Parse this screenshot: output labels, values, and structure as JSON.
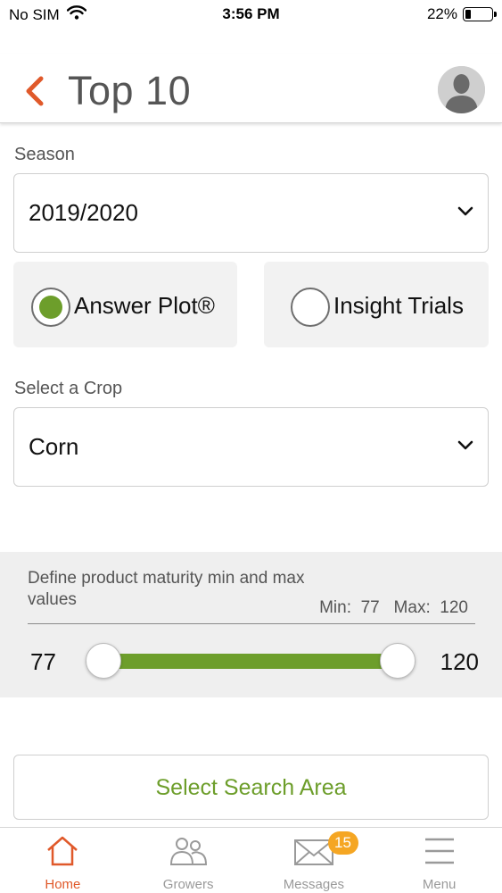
{
  "status_bar": {
    "carrier": "No SIM",
    "time": "3:56 PM",
    "battery_percent": "22%",
    "battery_level": 0.22
  },
  "header": {
    "title": "Top 10"
  },
  "season": {
    "label": "Season",
    "value": "2019/2020"
  },
  "trial_type": {
    "options": [
      {
        "label": "Answer Plot®",
        "selected": true
      },
      {
        "label": "Insight Trials",
        "selected": false
      }
    ]
  },
  "crop": {
    "label": "Select a Crop",
    "value": "Corn"
  },
  "maturity": {
    "description": "Define product maturity min and max values",
    "min_label": "Min:",
    "min_value": "77",
    "max_label": "Max:",
    "max_value": "120",
    "range_min_display": "77",
    "range_max_display": "120"
  },
  "search_button": {
    "label": "Select Search Area"
  },
  "tabbar": {
    "items": [
      {
        "label": "Home",
        "icon": "home-icon",
        "active": true
      },
      {
        "label": "Growers",
        "icon": "growers-icon",
        "active": false
      },
      {
        "label": "Messages",
        "icon": "envelope-icon",
        "active": false,
        "badge": "15"
      },
      {
        "label": "Menu",
        "icon": "hamburger-icon",
        "active": false
      }
    ]
  },
  "colors": {
    "accent_orange": "#e0592a",
    "accent_green": "#6d9e2b",
    "badge": "#f5a623"
  }
}
